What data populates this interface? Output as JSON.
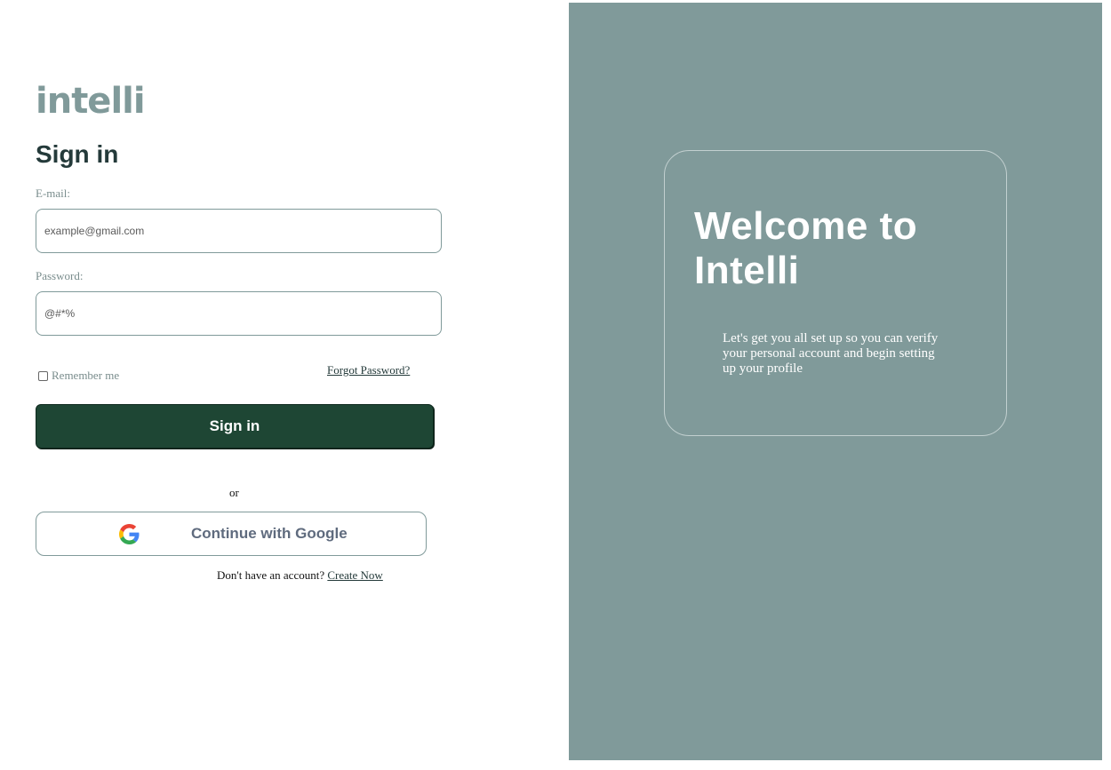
{
  "logo": {
    "text": "intelli"
  },
  "signin": {
    "title": "Sign in",
    "email_label": "E-mail:",
    "email_placeholder": "example@gmail.com",
    "password_label": "Password:",
    "password_placeholder": "@#*%",
    "remember_label": "Remember me",
    "forgot_label": "Forgot Password?",
    "button_label": "Sign in",
    "or_text": "or",
    "google_label": "Continue with Google",
    "no_account_text": "Don't have an account?",
    "create_label": "Create Now"
  },
  "welcome": {
    "title": "Welcome to Intelli",
    "subtitle": "Let's get you all set up so you can verify your personal account and begin setting up your profile"
  },
  "colors": {
    "brand": "#809a9a",
    "primary_button": "#1e4634",
    "heading": "#243a3a"
  },
  "icons": {
    "google": "google-icon",
    "checkbox": "checkbox-icon"
  }
}
